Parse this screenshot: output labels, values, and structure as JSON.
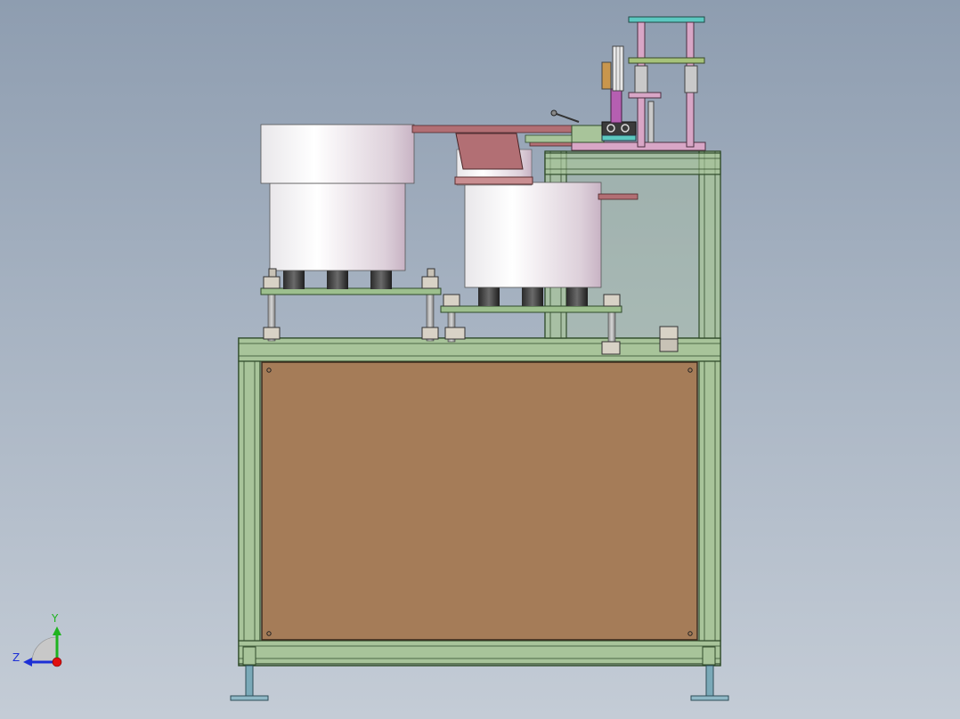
{
  "axis_triad": {
    "y_label": "Y",
    "z_label": "Z",
    "colors": {
      "y": "#1fb31f",
      "z": "#1c2fd6",
      "x": "#e01010"
    }
  },
  "palette": {
    "frame_fill": "#a8c49a",
    "frame_stroke": "#2f4a2a",
    "panel": "#a57c58",
    "bowl_light": "#f8f6f8",
    "bowl_shadow": "#cbb8c8",
    "rail": "#b26f74",
    "mechanism_pink": "#d8a6c6",
    "mechanism_teal": "#5cc8c0",
    "foot": "#7aa9b8"
  }
}
